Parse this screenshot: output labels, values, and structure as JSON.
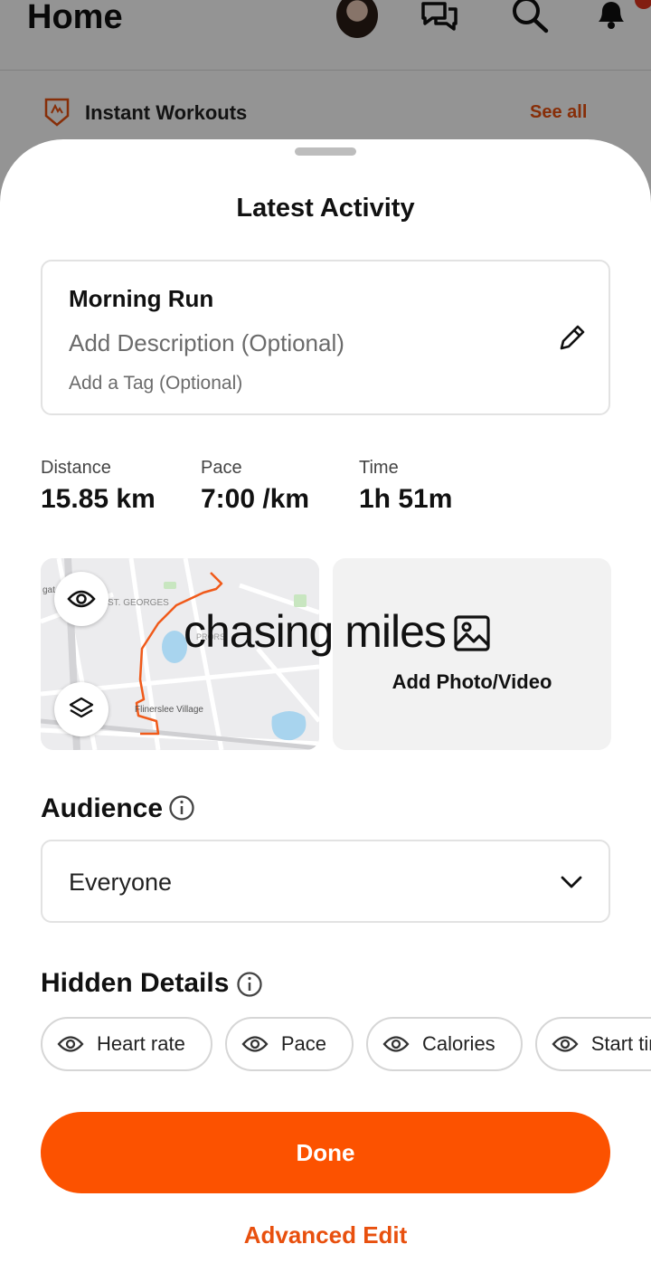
{
  "background": {
    "title": "Home",
    "row_label": "Instant Workouts",
    "row_link": "See all"
  },
  "sheet": {
    "title": "Latest Activity",
    "activity": {
      "name": "Morning Run",
      "description_placeholder": "Add Description (Optional)",
      "tag_placeholder": "Add a Tag (Optional)"
    },
    "stats": [
      {
        "label": "Distance",
        "value": "15.85 km"
      },
      {
        "label": "Pace",
        "value": "7:00 /km"
      },
      {
        "label": "Time",
        "value": "1h 51m"
      }
    ],
    "map": {
      "labels": [
        "gat",
        "ST. GEORGES",
        "PRORS",
        "Flinerslee Village"
      ]
    },
    "photo_label": "Add Photo/Video",
    "overlay_text": "chasing miles",
    "audience": {
      "title": "Audience",
      "value": "Everyone"
    },
    "hidden_details": {
      "title": "Hidden Details",
      "chips": [
        "Heart rate",
        "Pace",
        "Calories",
        "Start time"
      ]
    },
    "done_label": "Done",
    "advanced_label": "Advanced Edit"
  },
  "colors": {
    "accent": "#fc5200",
    "link": "#e8500e",
    "route": "#f05a1a"
  }
}
